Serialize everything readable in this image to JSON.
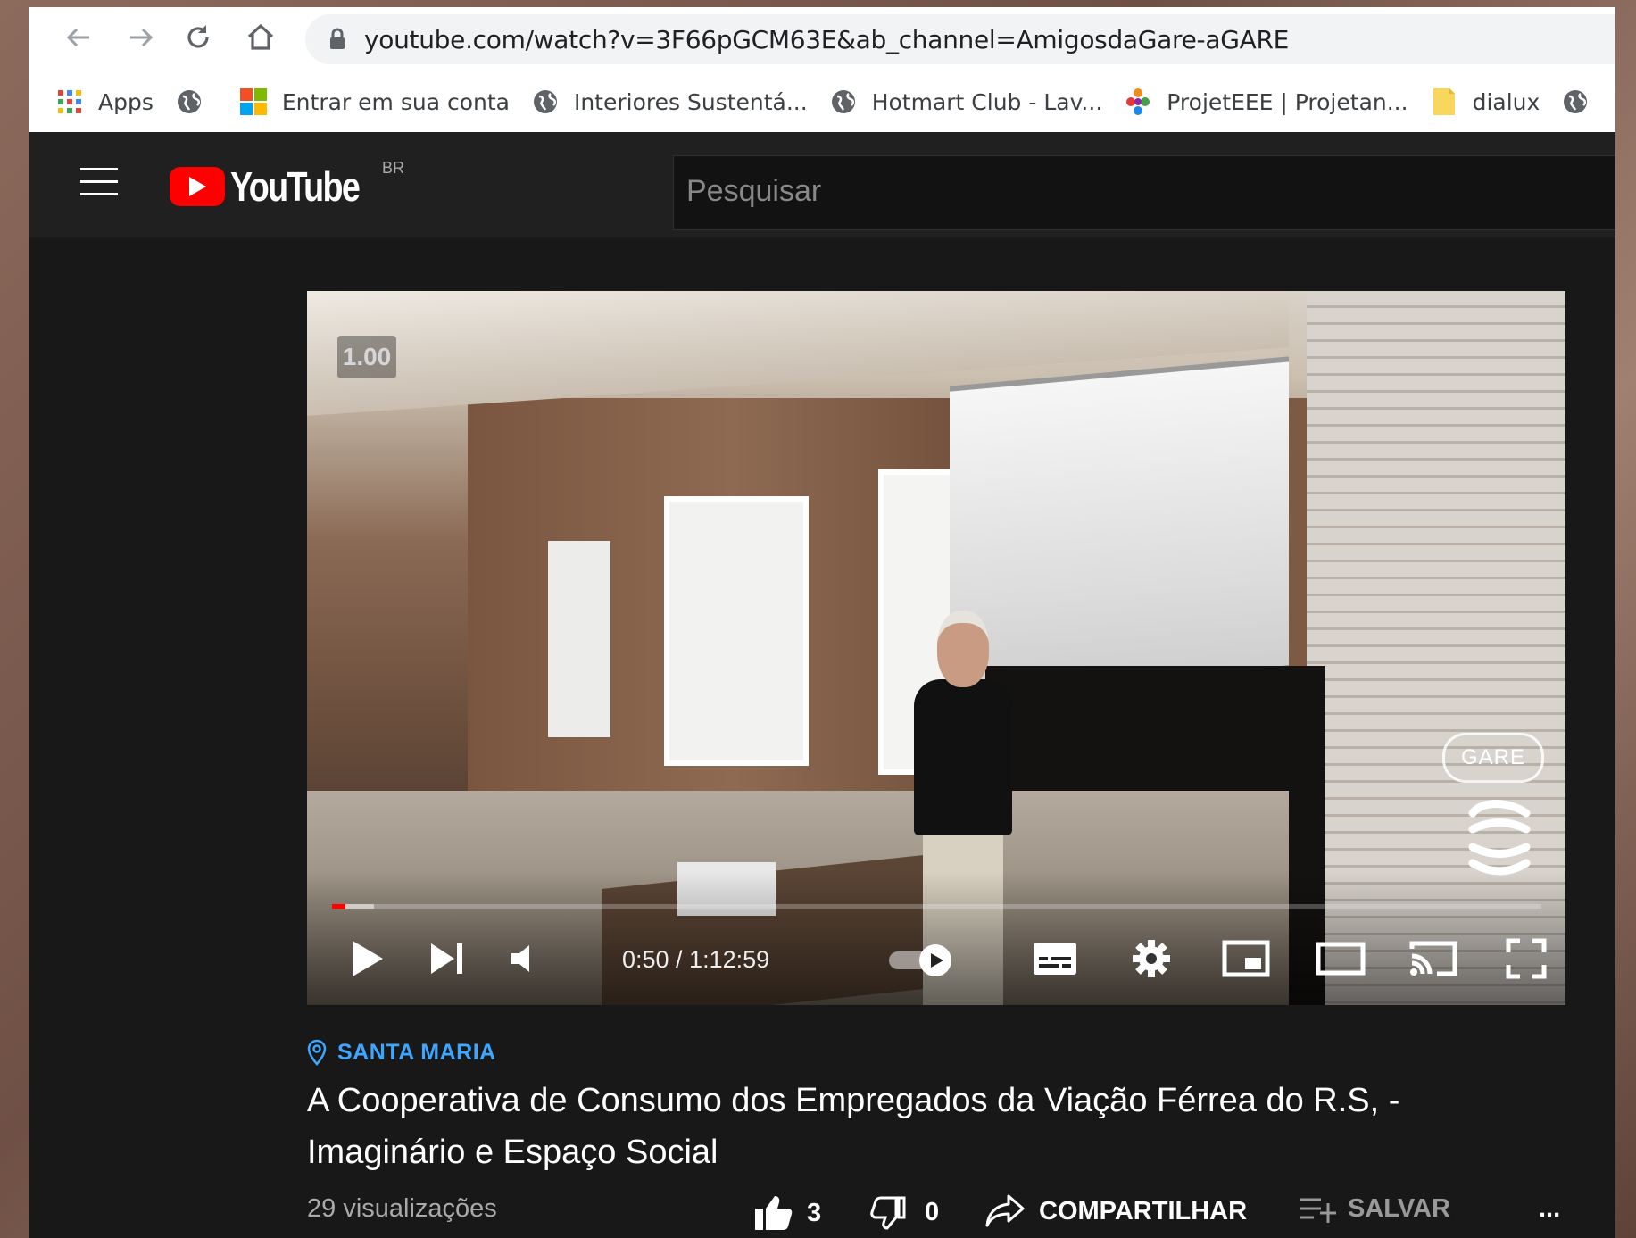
{
  "browser": {
    "url": "youtube.com/watch?v=3F66pGCM63E&ab_channel=AmigosdaGare-aGARE",
    "bookmarks": [
      {
        "label": "Apps",
        "icon": "apps-grid-icon"
      },
      {
        "label": "",
        "icon": "globe-icon"
      },
      {
        "label": "Entrar em sua conta",
        "icon": "microsoft-logo-icon"
      },
      {
        "label": "Interiores Sustentá...",
        "icon": "globe-icon"
      },
      {
        "label": "Hotmart Club - Lav...",
        "icon": "globe-icon"
      },
      {
        "label": "ProjetEEE | Projetan...",
        "icon": "projeteee-logo-icon"
      },
      {
        "label": "dialux",
        "icon": "folder-icon"
      },
      {
        "label": "",
        "icon": "globe-icon"
      }
    ]
  },
  "header": {
    "logo_text": "YouTube",
    "country_code": "BR",
    "search_placeholder": "Pesquisar"
  },
  "player": {
    "speed_badge": "1.00",
    "watermark": "GARE",
    "time_display": "0:50 / 1:12:59",
    "progress_fraction": 0.0114,
    "buffered_fraction": 0.035
  },
  "video": {
    "location": "SANTA MARIA",
    "title": "A Cooperativa de Consumo dos Empregados da Viação Férrea do R.S, - Imaginário e Espaço Social",
    "views": "29 visualizações",
    "likes": "3",
    "dislikes": "0",
    "share_label": "COMPARTILHAR",
    "save_label": "SALVAR",
    "more_label": "..."
  },
  "colors": {
    "accent": "#ff0000",
    "link": "#3ea6ff",
    "background": "#181818",
    "header": "#202020"
  }
}
